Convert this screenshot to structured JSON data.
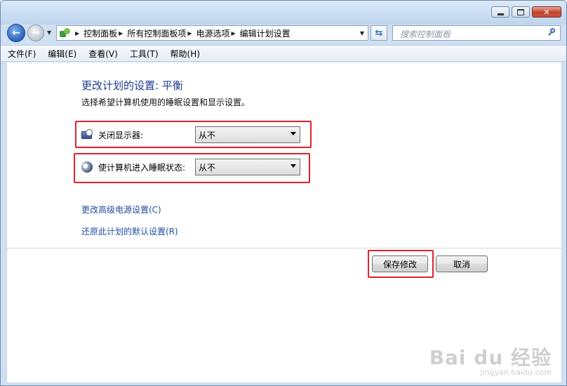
{
  "address": {
    "crumbs": [
      "控制面板",
      "所有控制面板项",
      "电源选项",
      "编辑计划设置"
    ]
  },
  "search": {
    "placeholder": "搜索控制面板"
  },
  "menu": [
    "文件(F)",
    "编辑(E)",
    "查看(V)",
    "工具(T)",
    "帮助(H)"
  ],
  "main": {
    "heading": "更改计划的设置: 平衡",
    "subtext": "选择希望计算机使用的睡眠设置和显示设置。",
    "display_off": {
      "label": "关闭显示器:",
      "value": "从不"
    },
    "sleep": {
      "label": "使计算机进入睡眠状态:",
      "value": "从不"
    },
    "link_advanced": "更改高级电源设置(C)",
    "link_restore": "还原此计划的默认设置(R)",
    "save_label": "保存修改",
    "cancel_label": "取消"
  },
  "watermark": {
    "main": "Bai du 经验",
    "sub": "jingyan.baidu.com"
  },
  "colors": {
    "highlight": "#e0222a",
    "link": "#1f4ea3",
    "heading": "#1e3c8c"
  }
}
